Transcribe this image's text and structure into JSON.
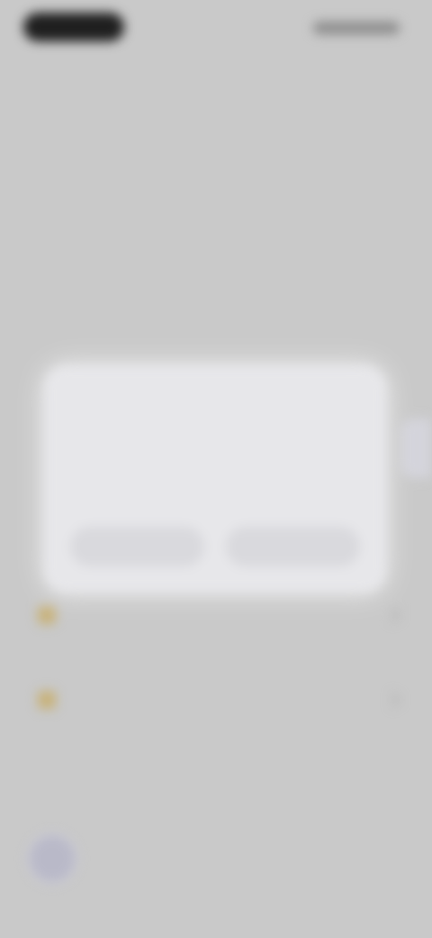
{
  "status_bar": {
    "time": "",
    "icons": ""
  },
  "header": {
    "title_link": "",
    "subtitle": "",
    "heading": "",
    "description": ""
  },
  "list": {
    "items": [
      {
        "label": ""
      },
      {
        "label": ""
      }
    ]
  },
  "dialog": {
    "title": "",
    "body": "",
    "cancel_label": "",
    "confirm_label": ""
  },
  "colors": {
    "background": "#c9c9c9",
    "dialog": "#e7e7ea",
    "accent": "#3a4fb0"
  }
}
